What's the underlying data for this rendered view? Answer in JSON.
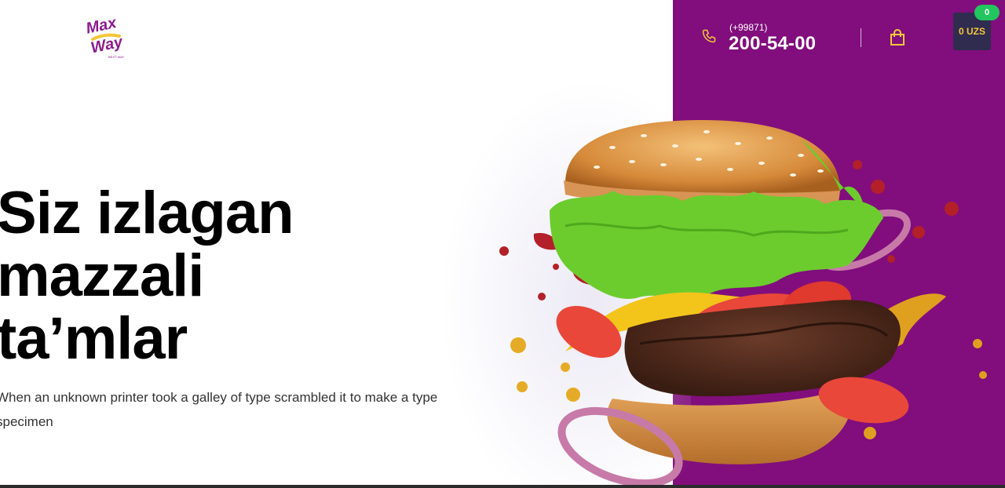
{
  "brand": {
    "logo_line1": "Max",
    "logo_line2": "Way",
    "logo_tagline": "BEST WAY"
  },
  "contact": {
    "phone_prefix": "(+99871)",
    "phone_number": "200-54-00"
  },
  "cart": {
    "total": "0 UZS",
    "count": "0"
  },
  "hero": {
    "title": "Siz izlagan\nmazzali\nta’mlar",
    "subtitle": "When an unknown printer took a galley of type scrambled it to make a type specimen"
  },
  "colors": {
    "brand_purple": "#810e7c",
    "accent_yellow": "#f4c73a",
    "cart_dark": "#2f2c4f",
    "badge_green": "#22c55e"
  },
  "icons": {
    "phone": "phone-icon",
    "bag": "shopping-bag-icon"
  }
}
